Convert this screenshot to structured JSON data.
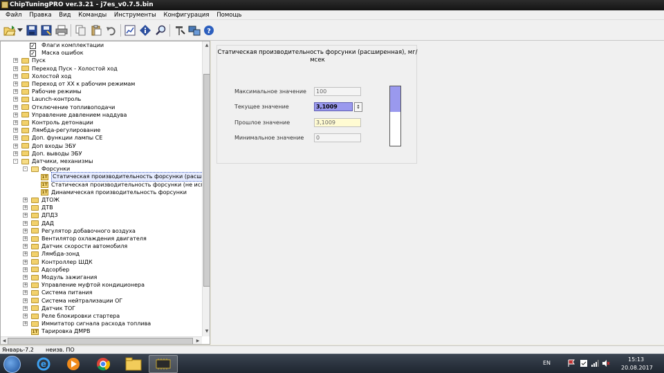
{
  "window": {
    "title": "ChipTuningPRO ver.3.21 - j7es_v0.7.5.bin"
  },
  "menu": [
    "Файл",
    "Правка",
    "Вид",
    "Команды",
    "Инструменты",
    "Конфигурация",
    "Помощь"
  ],
  "toolbar": {
    "icons": [
      "open-icon",
      "dropdown-arrow-icon",
      "save-icon",
      "save-as-icon",
      "print-icon",
      "copy-icon",
      "paste-icon",
      "undo-icon",
      "chart-icon",
      "diamond-info-icon",
      "search-icon",
      "tools-icon",
      "connect-icon",
      "help-icon"
    ]
  },
  "tree": {
    "items": [
      {
        "label": "Флаги комплектации",
        "type": "check",
        "indent": 2
      },
      {
        "label": "Маска ошибок",
        "type": "check",
        "indent": 2
      },
      {
        "label": "Пуск",
        "type": "folder",
        "indent": 1,
        "expander": "+"
      },
      {
        "label": "Переход Пуск - Холостой ход",
        "type": "folder",
        "indent": 1,
        "expander": "+"
      },
      {
        "label": "Холостой ход",
        "type": "folder",
        "indent": 1,
        "expander": "+"
      },
      {
        "label": "Переход от ХХ к рабочим режимам",
        "type": "folder",
        "indent": 1,
        "expander": "+"
      },
      {
        "label": "Рабочие режимы",
        "type": "folder",
        "indent": 1,
        "expander": "+"
      },
      {
        "label": "Launch-контроль",
        "type": "folder",
        "indent": 1,
        "expander": "+"
      },
      {
        "label": "Отключение топливоподачи",
        "type": "folder",
        "indent": 1,
        "expander": "+"
      },
      {
        "label": "Управление давлением наддува",
        "type": "folder",
        "indent": 1,
        "expander": "+"
      },
      {
        "label": "Контроль детонации",
        "type": "folder",
        "indent": 1,
        "expander": "+"
      },
      {
        "label": "Лямбда-регулирование",
        "type": "folder",
        "indent": 1,
        "expander": "+"
      },
      {
        "label": "Доп. функции лампы СЕ",
        "type": "folder",
        "indent": 1,
        "expander": "+"
      },
      {
        "label": "Доп входы ЭБУ",
        "type": "folder",
        "indent": 1,
        "expander": "+"
      },
      {
        "label": "Доп. выводы ЭБУ",
        "type": "folder",
        "indent": 1,
        "expander": "+"
      },
      {
        "label": "Датчики, механизмы",
        "type": "folder-open",
        "indent": 1,
        "expander": "-"
      },
      {
        "label": "Форсунки",
        "type": "folder-open",
        "indent": 2,
        "expander": "-"
      },
      {
        "label": "Статическая производительность форсунки (расширенная)",
        "type": "param",
        "indent": 3,
        "selected": true
      },
      {
        "label": "Статическая производительность форсунки (не используется)",
        "type": "param",
        "indent": 3
      },
      {
        "label": "Динамическая производительность форсунки",
        "type": "param",
        "indent": 3
      },
      {
        "label": "ДТОЖ",
        "type": "folder",
        "indent": 2,
        "expander": "+"
      },
      {
        "label": "ДТВ",
        "type": "folder",
        "indent": 2,
        "expander": "+"
      },
      {
        "label": "ДПДЗ",
        "type": "folder",
        "indent": 2,
        "expander": "+"
      },
      {
        "label": "ДАД",
        "type": "folder",
        "indent": 2,
        "expander": "+"
      },
      {
        "label": "Регулятор добавочного воздуха",
        "type": "folder",
        "indent": 2,
        "expander": "+"
      },
      {
        "label": "Вентилятор охлаждения двигателя",
        "type": "folder",
        "indent": 2,
        "expander": "+"
      },
      {
        "label": "Датчик скорости автомобиля",
        "type": "folder",
        "indent": 2,
        "expander": "+"
      },
      {
        "label": "Лямбда-зонд",
        "type": "folder",
        "indent": 2,
        "expander": "+"
      },
      {
        "label": "Контроллер ШДК",
        "type": "folder",
        "indent": 2,
        "expander": "+"
      },
      {
        "label": "Адсорбер",
        "type": "folder",
        "indent": 2,
        "expander": "+"
      },
      {
        "label": "Модуль зажигания",
        "type": "folder",
        "indent": 2,
        "expander": "+"
      },
      {
        "label": "Управление муфтой кондиционера",
        "type": "folder",
        "indent": 2,
        "expander": "+"
      },
      {
        "label": "Система питания",
        "type": "folder",
        "indent": 2,
        "expander": "+"
      },
      {
        "label": "Система нейтрализации ОГ",
        "type": "folder",
        "indent": 2,
        "expander": "+"
      },
      {
        "label": "Датчик ТОГ",
        "type": "folder",
        "indent": 2,
        "expander": "+"
      },
      {
        "label": "Реле блокировки стартера",
        "type": "folder",
        "indent": 2,
        "expander": "+"
      },
      {
        "label": "Иммитатор сигнала расхода топлива",
        "type": "folder",
        "indent": 2,
        "expander": "+"
      },
      {
        "label": "Тарировка ДМРВ",
        "type": "param",
        "indent": 2
      }
    ]
  },
  "param": {
    "title": "Статическая производительность форсунки (расширенная), мг/мсек",
    "max_label": "Максимальное значение",
    "max_value": "100",
    "current_label": "Текущее значение",
    "current_value": "3,1009",
    "previous_label": "Прошлое значение",
    "previous_value": "3,1009",
    "min_label": "Минимальное значение",
    "min_value": "0",
    "gauge_level": 0.43,
    "gauge_color": "#9a99ee"
  },
  "status": {
    "left": "Январь-7.2",
    "right": "неизв. ПО"
  },
  "taskbar": {
    "apps": [
      "internet-explorer-icon",
      "media-player-icon",
      "chrome-icon",
      "file-explorer-icon",
      "chiptuningpro-icon"
    ],
    "lang": "EN",
    "time": "15:13",
    "date": "20.08.2017"
  }
}
